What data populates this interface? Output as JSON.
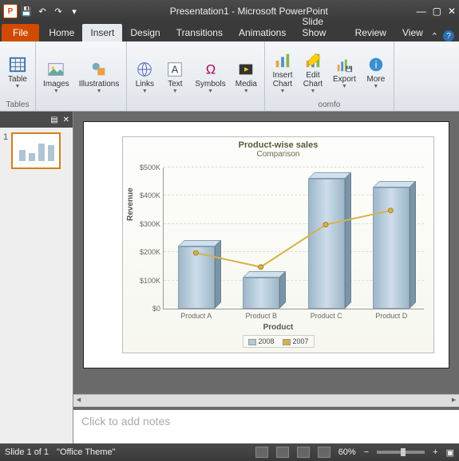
{
  "window": {
    "title": "Presentation1 - Microsoft PowerPoint"
  },
  "qat": {
    "save": "save",
    "undo": "undo",
    "redo": "redo",
    "qdd": "▾"
  },
  "tabs": {
    "file": "File",
    "items": [
      "Home",
      "Insert",
      "Design",
      "Transitions",
      "Animations",
      "Slide Show",
      "Review",
      "View"
    ],
    "active": "Insert"
  },
  "ribbon": {
    "groups": [
      {
        "label": "Tables",
        "buttons": [
          {
            "label": "Table",
            "icon": "table-icon",
            "dd": true
          }
        ]
      },
      {
        "label": "",
        "buttons": [
          {
            "label": "Images",
            "icon": "image-icon",
            "dd": true
          },
          {
            "label": "Illustrations",
            "icon": "shapes-icon",
            "dd": true
          }
        ]
      },
      {
        "label": "",
        "buttons": [
          {
            "label": "Links",
            "icon": "link-icon",
            "dd": true
          },
          {
            "label": "Text",
            "icon": "text-icon",
            "dd": true
          },
          {
            "label": "Symbols",
            "icon": "symbol-icon",
            "dd": true
          },
          {
            "label": "Media",
            "icon": "media-icon",
            "dd": true
          }
        ]
      },
      {
        "label": "oomfo",
        "buttons": [
          {
            "label": "Insert\nChart",
            "icon": "insert-chart-icon",
            "dd": true
          },
          {
            "label": "Edit\nChart",
            "icon": "edit-chart-icon",
            "dd": true
          },
          {
            "label": "Export",
            "icon": "export-icon",
            "dd": true
          },
          {
            "label": "More",
            "icon": "more-icon",
            "dd": true
          }
        ]
      }
    ]
  },
  "chart_data": {
    "type": "bar",
    "title": "Product-wise sales",
    "subtitle": "Comparison",
    "xlabel": "Product",
    "ylabel": "Revenue",
    "categories": [
      "Product A",
      "Product B",
      "Product C",
      "Product D"
    ],
    "yticks": [
      "$0",
      "$100K",
      "$200K",
      "$300K",
      "$400K",
      "$500K"
    ],
    "ylim": [
      0,
      500000
    ],
    "series": [
      {
        "name": "2008",
        "type": "bar",
        "values": [
          220000,
          110000,
          460000,
          430000
        ],
        "color": "#b4cad9"
      },
      {
        "name": "2007",
        "type": "line",
        "values": [
          200000,
          150000,
          300000,
          350000
        ],
        "color": "#d6b24a"
      }
    ]
  },
  "notes_placeholder": "Click to add notes",
  "status": {
    "slide": "Slide 1 of 1",
    "theme": "\"Office Theme\"",
    "zoom": "60%"
  },
  "thumb": {
    "num": "1"
  }
}
